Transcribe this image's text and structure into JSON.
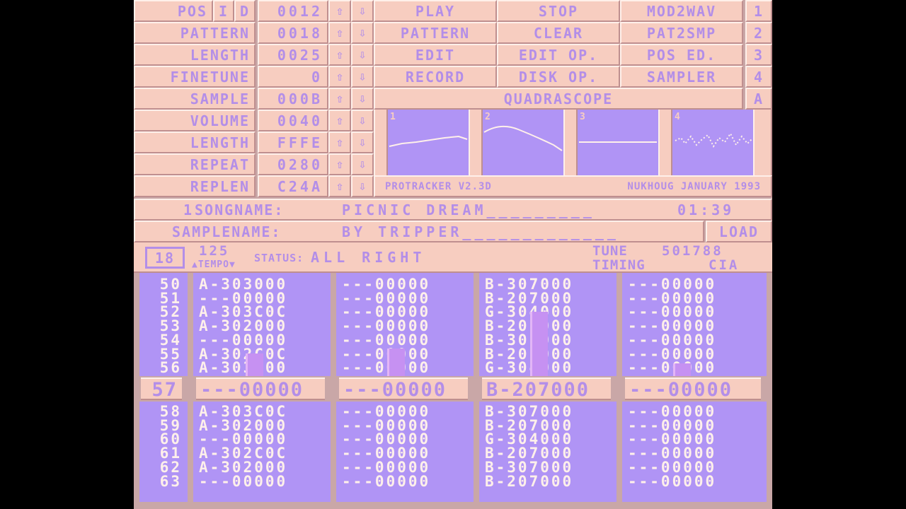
{
  "controls": {
    "rows": [
      {
        "label": "POS",
        "value": "0012"
      },
      {
        "label": "PATTERN",
        "value": "0018"
      },
      {
        "label": "LENGTH",
        "value": "0025"
      },
      {
        "label": "FINETUNE",
        "value": "0"
      },
      {
        "label": "SAMPLE",
        "value": "000B"
      },
      {
        "label": "VOLUME",
        "value": "0040"
      },
      {
        "label": "LENGTH",
        "value": "FFFE"
      },
      {
        "label": "REPEAT",
        "value": "0280"
      },
      {
        "label": "REPLEN",
        "value": "C24A"
      }
    ],
    "ins_label": "I",
    "del_label": "D",
    "up_arrow": "⇧",
    "down_arrow": "⇩"
  },
  "menu": {
    "rows": [
      [
        "PLAY",
        "STOP",
        "MOD2WAV"
      ],
      [
        "PATTERN",
        "CLEAR",
        "PAT2SMP"
      ],
      [
        "EDIT",
        "EDIT OP.",
        "POS ED."
      ],
      [
        "RECORD",
        "DISK OP.",
        "SAMPLER"
      ]
    ],
    "side": [
      "1",
      "2",
      "3",
      "4"
    ],
    "scope_title": "QUADRASCOPE",
    "scope_side": "A"
  },
  "scope": {
    "channels": [
      "1",
      "2",
      "3",
      "4"
    ],
    "version": "PROTRACKER V2.3D",
    "credit": "NUKHOUG JANUARY 1993"
  },
  "song": {
    "num": "1",
    "label": "SONGNAME:",
    "name": "PICNIC DREAM_________",
    "time": "01:39"
  },
  "sample": {
    "label": "SAMPLENAME:",
    "name": "BY TRIPPER_____________",
    "load": "LOAD"
  },
  "status": {
    "octave": "18",
    "tempo_value": "125",
    "tempo_label": "TEMPO",
    "status_label": "STATUS:",
    "status_text": "ALL RIGHT",
    "tune_label": "TUNE",
    "tune_value": "501788",
    "timing_label": "TIMING",
    "timing_value": "CIA"
  },
  "pattern": {
    "above": [
      {
        "n": "50",
        "t": [
          "A-303000",
          "---00000",
          "B-307000",
          "---00000"
        ]
      },
      {
        "n": "51",
        "t": [
          "---00000",
          "---00000",
          "B-207000",
          "---00000"
        ]
      },
      {
        "n": "52",
        "t": [
          "A-303C0C",
          "---00000",
          "G-304000",
          "---00000"
        ]
      },
      {
        "n": "53",
        "t": [
          "A-302000",
          "---00000",
          "B-207000",
          "---00000"
        ]
      },
      {
        "n": "54",
        "t": [
          "---00000",
          "---00000",
          "B-307000",
          "---00000"
        ]
      },
      {
        "n": "55",
        "t": [
          "A-302C0C",
          "---00000",
          "B-207000",
          "---00000"
        ]
      },
      {
        "n": "56",
        "t": [
          "A-303000",
          "---00000",
          "G-304000",
          "---00000"
        ]
      }
    ],
    "current": {
      "n": "57",
      "t": [
        "---00000",
        "---00000",
        "B-207000",
        "---00000"
      ]
    },
    "below": [
      {
        "n": "58",
        "t": [
          "A-303C0C",
          "---00000",
          "B-307000",
          "---00000"
        ]
      },
      {
        "n": "59",
        "t": [
          "A-302000",
          "---00000",
          "B-207000",
          "---00000"
        ]
      },
      {
        "n": "60",
        "t": [
          "---00000",
          "---00000",
          "G-304000",
          "---00000"
        ]
      },
      {
        "n": "61",
        "t": [
          "A-302C0C",
          "---00000",
          "B-207000",
          "---00000"
        ]
      },
      {
        "n": "62",
        "t": [
          "A-302000",
          "---00000",
          "B-307000",
          "---00000"
        ]
      },
      {
        "n": "63",
        "t": [
          "---00000",
          "---00000",
          "B-207000",
          "---00000"
        ]
      }
    ],
    "vu_levels": [
      0.22,
      0.27,
      0.62,
      0.12
    ]
  },
  "colors": {
    "panel": "#f7cdc0",
    "text": "#b38ee8",
    "pattern_bg": "#b094f5",
    "pattern_text": "#fff0ea"
  }
}
